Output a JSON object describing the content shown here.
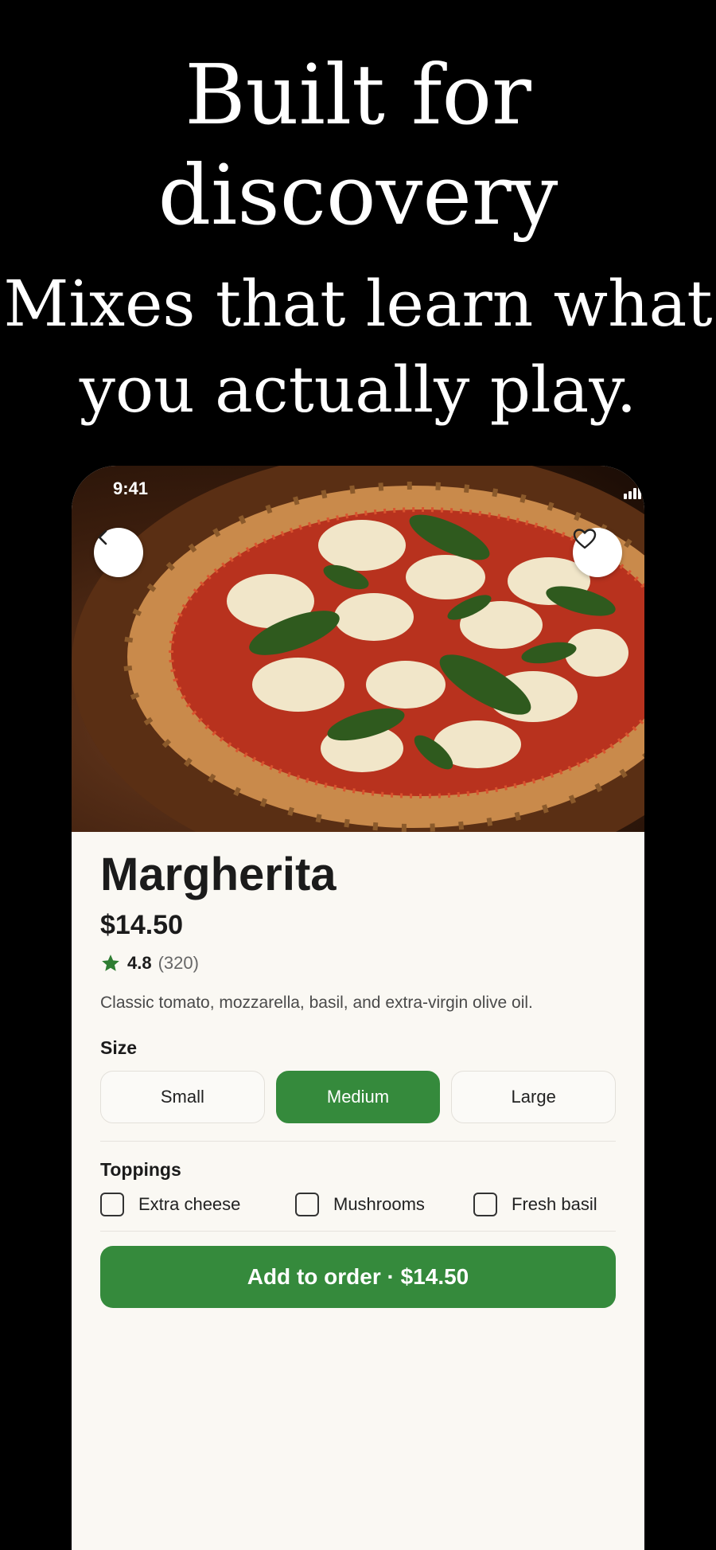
{
  "headline": {
    "title": "Built for discovery",
    "subtitle": "Mixes that learn what you actually play."
  },
  "status_bar": {
    "time": "9:41"
  },
  "product": {
    "name": "Margherita",
    "price": "$14.50",
    "rating": "4.8",
    "review_count": "(320)",
    "description": "Classic tomato, mozzarella, basil, and extra-virgin olive oil."
  },
  "size": {
    "label": "Size",
    "options": [
      "Small",
      "Medium",
      "Large"
    ],
    "selected": "Medium"
  },
  "toppings": {
    "label": "Toppings",
    "items": [
      "Extra cheese",
      "Mushrooms",
      "Fresh basil"
    ]
  },
  "cta": {
    "label": "Add to order · $14.50"
  },
  "colors": {
    "accent": "#358a3c",
    "star": "#2e7d32",
    "background": "#000000",
    "sheet": "#faf8f3"
  }
}
